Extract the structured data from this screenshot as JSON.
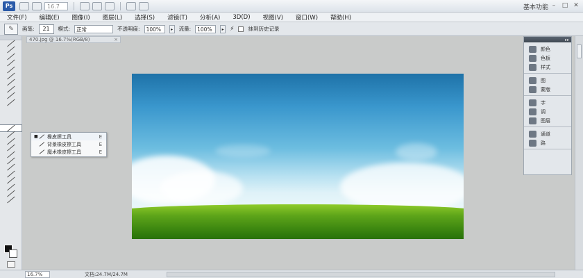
{
  "app": {
    "logo": "Ps",
    "zoom_preset": "16.7",
    "workspace": "基本功能",
    "win_minimize": "–",
    "win_restore": "□",
    "win_close": "✕"
  },
  "menu": [
    "文件(F)",
    "编辑(E)",
    "图像(I)",
    "图层(L)",
    "选择(S)",
    "滤镜(T)",
    "分析(A)",
    "3D(D)",
    "视图(V)",
    "窗口(W)",
    "帮助(H)"
  ],
  "options": {
    "brush_label": "画笔:",
    "brush_size": "21",
    "mode_label": "模式:",
    "mode_value": "正常",
    "opacity_label": "不透明度:",
    "opacity_value": "100%",
    "flow_label": "流量:",
    "flow_value": "100%",
    "history_label": "抹到历史记录"
  },
  "document": {
    "tab_title": "470.jpg @ 16.7%(RGB/8)",
    "close": "×"
  },
  "flyout": [
    {
      "label": "橡皮擦工具",
      "key": "E",
      "active": true
    },
    {
      "label": "背景橡皮擦工具",
      "key": "E",
      "active": false
    },
    {
      "label": "魔术橡皮擦工具",
      "key": "E",
      "active": false
    }
  ],
  "panels": {
    "group1": [
      "颜色",
      "色板",
      "样式"
    ],
    "group2": [
      "图",
      "蒙版"
    ],
    "group3": [
      "字",
      "调",
      "图层"
    ],
    "group4": [
      "通道",
      "路"
    ]
  },
  "status": {
    "zoom": "16.7%",
    "doc_info": "文档:24.7M/24.7M"
  },
  "colors": {
    "foreground": "#111111",
    "background": "#ffffff",
    "accent": "#2a5aa8"
  }
}
